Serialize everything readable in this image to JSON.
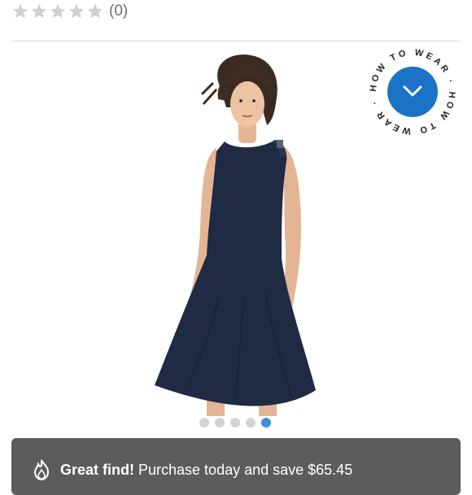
{
  "rating": {
    "stars_filled": 0,
    "stars_total": 5,
    "review_count": "(0)"
  },
  "product": {
    "image_alt": "Model wearing navy sleeveless fit-and-flare dress"
  },
  "how_to_wear": {
    "ring_text": "HOW TO WEAR · HOW TO WEAR · "
  },
  "carousel": {
    "total": 5,
    "active_index": 4
  },
  "promo": {
    "title": "Great find!",
    "text": "Purchase today and save $65.45"
  },
  "colors": {
    "accent": "#1a73c7",
    "dress": "#1f2a44",
    "promo_bg": "#5c5c5c",
    "star_empty": "#d0d0d0"
  },
  "icons": {
    "star": "star-icon",
    "chevron": "chevron-down-icon",
    "flame": "flame-icon"
  }
}
